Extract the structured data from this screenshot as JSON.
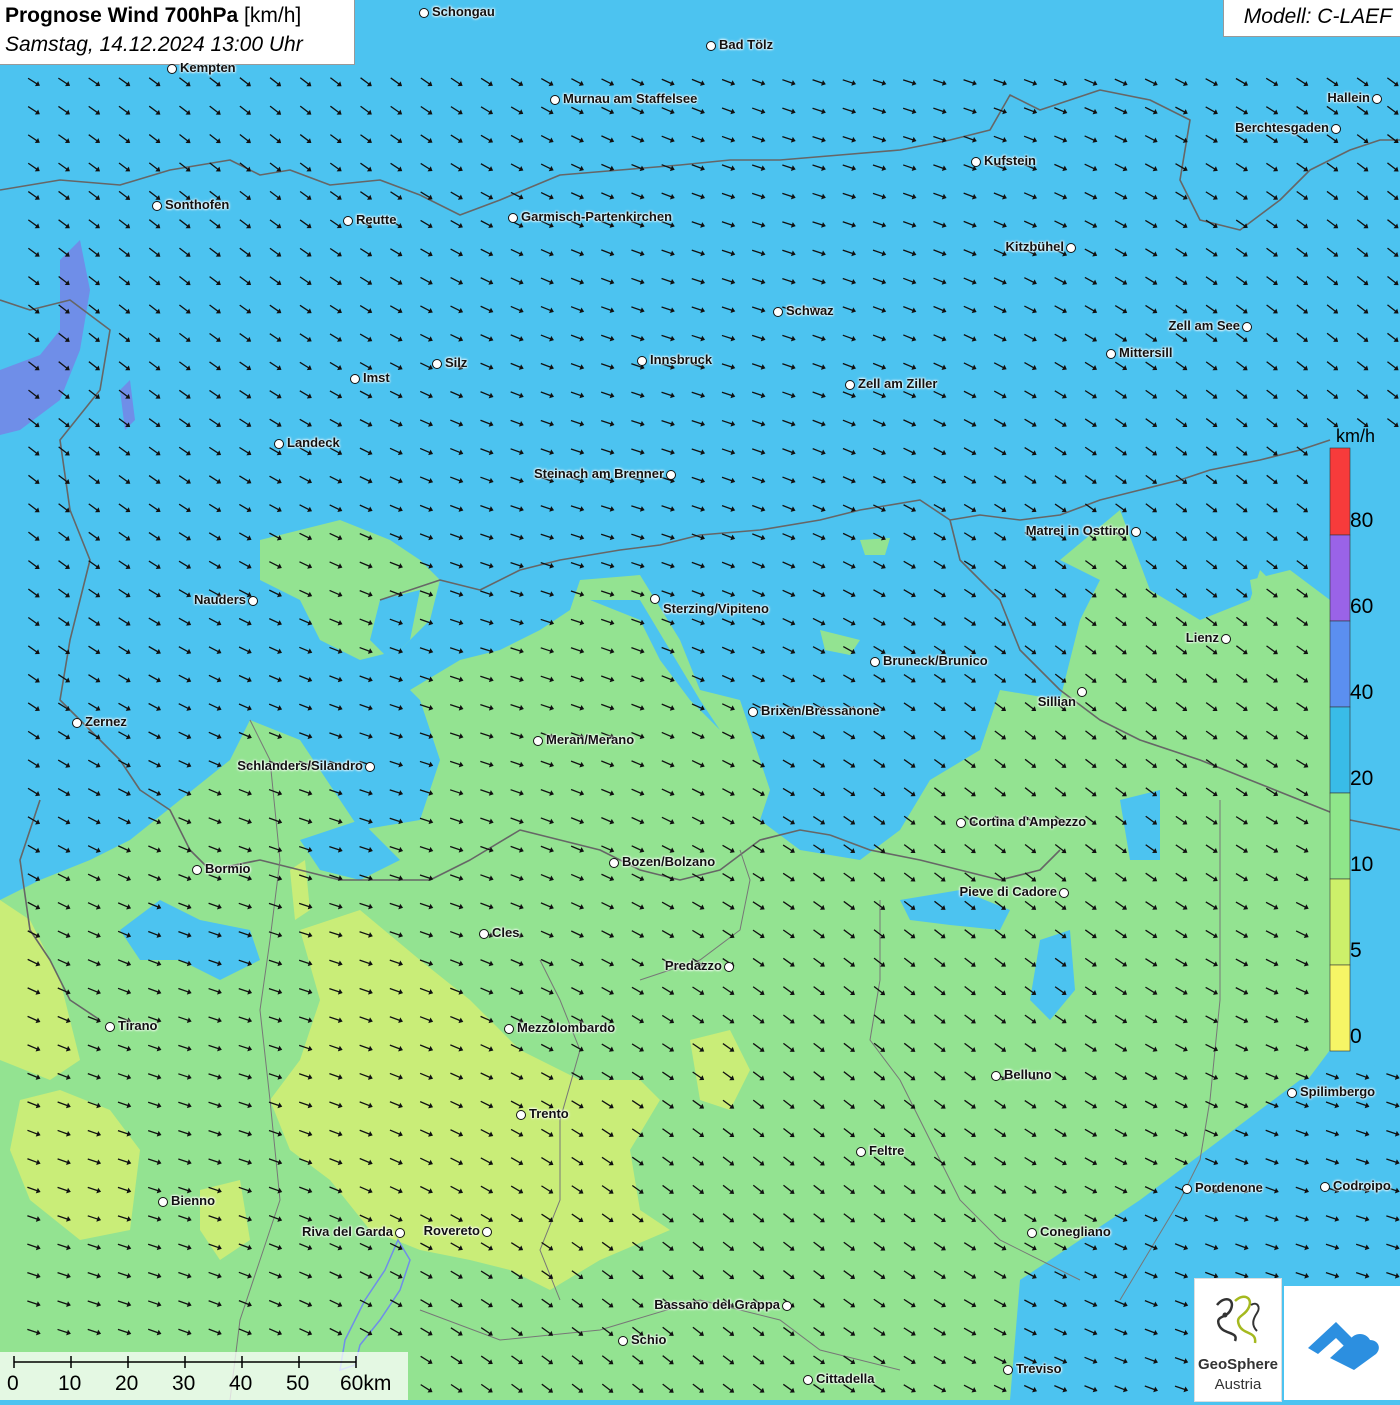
{
  "header": {
    "title_bold": "Prognose Wind 700hPa",
    "title_unit": "[km/h]",
    "datetime": "Samstag, 14.12.2024 13:00 Uhr",
    "model": "Modell: C-LAEF"
  },
  "legend": {
    "unit": "km/h",
    "labels": [
      "80",
      "60",
      "40",
      "20",
      "10",
      "5",
      "0"
    ],
    "colors": [
      "#f73b3b",
      "#9a63e8",
      "#5b8ff0",
      "#39bce8",
      "#8fe68a",
      "#cdf06a",
      "#f6f566"
    ]
  },
  "scale": {
    "labels": [
      "0",
      "10",
      "20",
      "30",
      "40",
      "50",
      "60km"
    ]
  },
  "colors": {
    "wind_20_40": "#4cc3f0",
    "wind_10_20": "#93e391",
    "wind_5_10": "#c9ed78",
    "wind_40_60": "#6f8ee8",
    "border": "#666666"
  },
  "cities": [
    {
      "name": "Schongau"
    },
    {
      "name": "Bad Tölz"
    },
    {
      "name": "Kempten"
    },
    {
      "name": "Murnau am Staffelsee"
    },
    {
      "name": "Hallein"
    },
    {
      "name": "Berchtesgaden"
    },
    {
      "name": "Kufstein"
    },
    {
      "name": "Sonthofen"
    },
    {
      "name": "Reutte"
    },
    {
      "name": "Garmisch-Partenkirchen"
    },
    {
      "name": "Kitzbühel"
    },
    {
      "name": "Schwaz"
    },
    {
      "name": "Zell am See"
    },
    {
      "name": "Mittersill"
    },
    {
      "name": "Innsbruck"
    },
    {
      "name": "Silz"
    },
    {
      "name": "Imst"
    },
    {
      "name": "Zell am Ziller"
    },
    {
      "name": "Landeck"
    },
    {
      "name": "Steinach am Brenner"
    },
    {
      "name": "Matrei in Osttirol"
    },
    {
      "name": "Nauders"
    },
    {
      "name": "Sterzing/Vipiteno"
    },
    {
      "name": "Lienz"
    },
    {
      "name": "Bruneck/Brunico"
    },
    {
      "name": "Sillian"
    },
    {
      "name": "Brixen/Bressanone"
    },
    {
      "name": "Zernez"
    },
    {
      "name": "Meran/Merano"
    },
    {
      "name": "Schlanders/Silandro"
    },
    {
      "name": "Cortina d'Ampezzo"
    },
    {
      "name": "Bozen/Bolzano"
    },
    {
      "name": "Bormio"
    },
    {
      "name": "Pieve di Cadore"
    },
    {
      "name": "Cles"
    },
    {
      "name": "Predazzo"
    },
    {
      "name": "Tirano"
    },
    {
      "name": "Mezzolombardo"
    },
    {
      "name": "Belluno"
    },
    {
      "name": "Spilimbergo"
    },
    {
      "name": "Trento"
    },
    {
      "name": "Feltre"
    },
    {
      "name": "Pordenone"
    },
    {
      "name": "Codroipo"
    },
    {
      "name": "Bienno"
    },
    {
      "name": "Riva del Garda"
    },
    {
      "name": "Rovereto"
    },
    {
      "name": "Conegliano"
    },
    {
      "name": "Bassano del Grappa"
    },
    {
      "name": "Schio"
    },
    {
      "name": "Treviso"
    },
    {
      "name": "Cittadella"
    }
  ],
  "logos": {
    "geosphere_line1": "GeoSphere",
    "geosphere_line2": "Austria"
  }
}
